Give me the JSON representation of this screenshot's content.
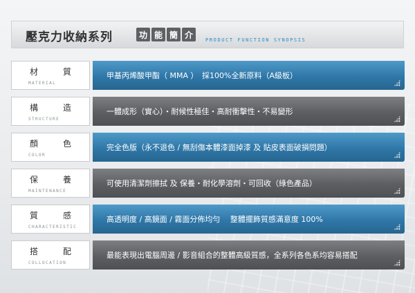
{
  "header": {
    "title": "壓克力收納系列",
    "chips": [
      "功",
      "能",
      "簡",
      "介"
    ],
    "subtitle": "PRODUCT FUNCTION SYNOPSIS"
  },
  "rows": [
    {
      "label_cn": [
        "材",
        "質"
      ],
      "label_en": "MATERIAL",
      "text": "甲基丙烯酸甲酯（ MMA ）　採100%全新原料（A級板）",
      "color": "blue"
    },
    {
      "label_cn": [
        "構",
        "造"
      ],
      "label_en": "STRUCTURE",
      "text": "一體成形（實心）・耐候性極佳・高耐衝擊性・不易變形",
      "color": "gray"
    },
    {
      "label_cn": [
        "顏",
        "色"
      ],
      "label_en": "COLOR",
      "text": "完全色版（永不退色 / 無刮傷本體漆面掉漆 及 貼皮表面破損問題）",
      "color": "blue"
    },
    {
      "label_cn": [
        "保",
        "養"
      ],
      "label_en": "MAINTENANCE",
      "text": "可使用清潔劑擦拭 及 保養・耐化學溶劑・可回收（綠色產品）",
      "color": "gray"
    },
    {
      "label_cn": [
        "質",
        "感"
      ],
      "label_en": "CHARACTERISTIC",
      "text": "高透明度 / 高鏡面 / 霧面分佈均勻　 整體擺飾質感滿意度 100%",
      "color": "blue"
    },
    {
      "label_cn": [
        "搭",
        "配"
      ],
      "label_en": "COLLOCATION",
      "text": "最能表現出電腦周邊 / 影音組合的整體高級質感，全系列各色系均容易搭配",
      "color": "gray"
    }
  ]
}
